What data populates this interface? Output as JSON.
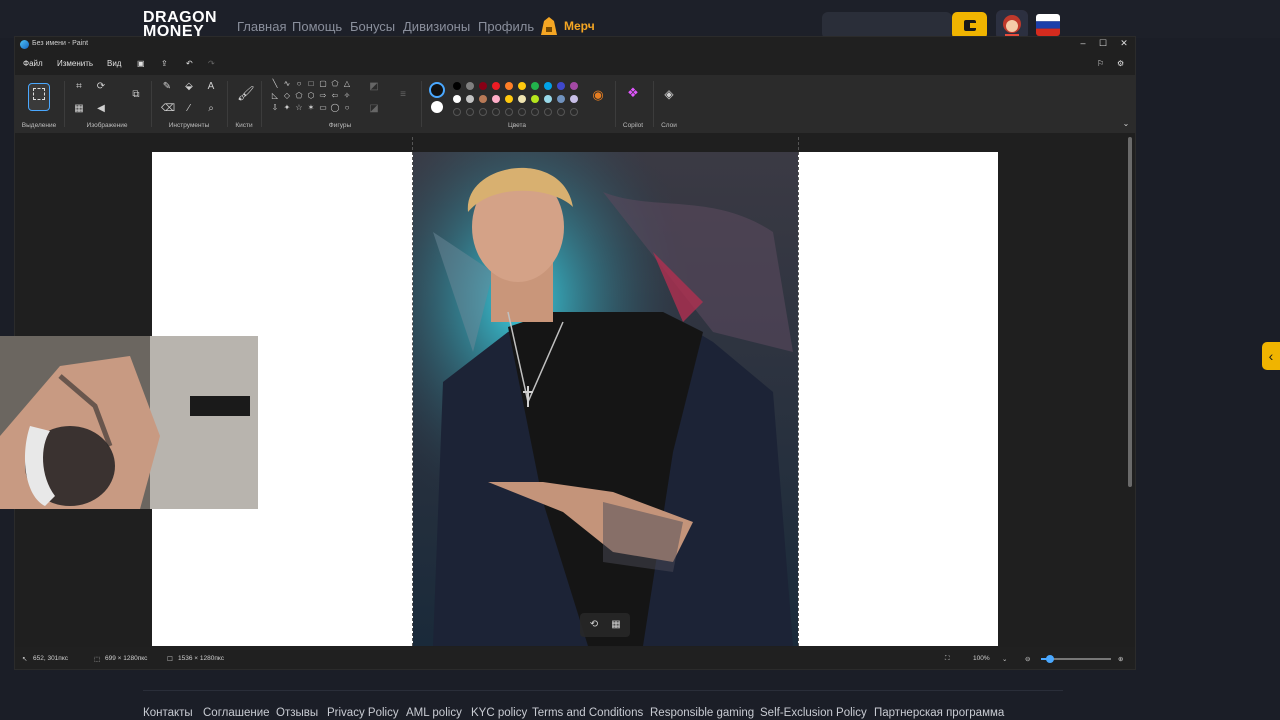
{
  "site": {
    "logo_line1": "DRAGON",
    "logo_line2": "MONEY",
    "nav": [
      "Главная",
      "Помощь",
      "Бонусы",
      "Дивизионы",
      "Профиль"
    ],
    "merch_label": "Мерч",
    "accent_color": "#f0b400"
  },
  "paint": {
    "title": "Без имени - Paint",
    "menu": [
      "Файл",
      "Изменить",
      "Вид"
    ],
    "ribbon_groups": [
      "Выделение",
      "Изображение",
      "Инструменты",
      "Кисти",
      "Фигуры",
      "Цвета",
      "Copilot",
      "Слои"
    ],
    "palette_row1": [
      "#000000",
      "#7f7f7f",
      "#880015",
      "#ed1c24",
      "#ff7f27",
      "#ffc90e",
      "#22b14c",
      "#00a2e8",
      "#3f48cc",
      "#a349a4"
    ],
    "palette_row2": [
      "#ffffff",
      "#c3c3c3",
      "#b97a57",
      "#ffaec9",
      "#ffc90e",
      "#efe4b0",
      "#b5e61d",
      "#99d9ea",
      "#7092be",
      "#c8bfe7"
    ],
    "status": {
      "cursor_pos": "652, 301пкс",
      "selection_size": "699 × 1280пкс",
      "canvas_size": "1536 × 1280пкс",
      "zoom": "100%"
    }
  },
  "footer": {
    "links": [
      "Контакты",
      "Соглашение",
      "Отзывы",
      "Privacy Policy",
      "AML policy",
      "KYC policy",
      "Terms and Conditions",
      "Responsible gaming",
      "Self-Exclusion Policy",
      "Партнерская программа"
    ]
  }
}
